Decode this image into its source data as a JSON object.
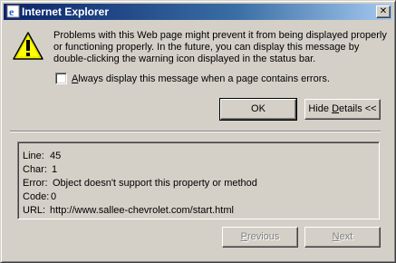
{
  "window": {
    "title": "Internet Explorer",
    "close_glyph": "✕"
  },
  "message": {
    "text": "Problems with this Web page might prevent it from being displayed properly or functioning properly. In the future, you can display this message by double-clicking the warning icon displayed in the status bar."
  },
  "checkbox": {
    "label_accel": "A",
    "label_rest": "lways display this message when a page contains errors.",
    "checked": false
  },
  "buttons": {
    "ok": "OK",
    "hide_details_pre": "Hide ",
    "hide_details_accel": "D",
    "hide_details_post": "etails <<",
    "previous_accel": "P",
    "previous_rest": "revious",
    "next_accel": "N",
    "next_rest": "ext"
  },
  "details": {
    "line_label": "Line:",
    "line_value": "45",
    "char_label": "Char:",
    "char_value": "1",
    "error_label": "Error:",
    "error_value": "Object doesn't support this property or method",
    "code_label": "Code:",
    "code_value": "0",
    "url_label": "URL:",
    "url_value": "http://www.sallee-chevrolet.com/start.html"
  },
  "colors": {
    "title_start": "#0a246a",
    "title_end": "#a6caf0",
    "face": "#d4d0c8",
    "warning_yellow": "#ffff00"
  },
  "icons": {
    "app": "internet-explorer-icon",
    "warning": "warning-icon",
    "close": "close-icon"
  }
}
